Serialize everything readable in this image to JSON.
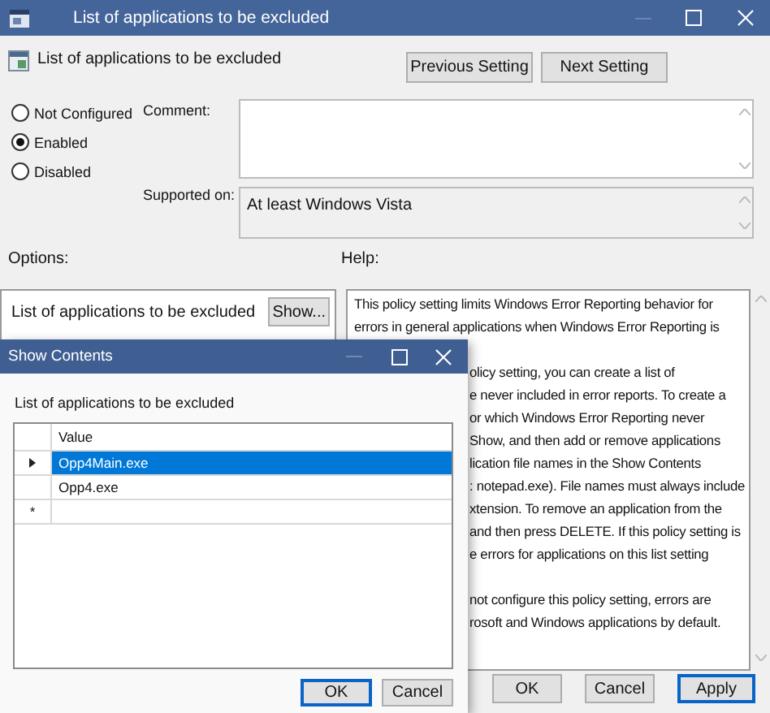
{
  "window": {
    "title": "List of applications to be excluded"
  },
  "header": {
    "title": "List of applications to be excluded",
    "buttons": [
      {
        "label": "Previous Setting"
      },
      {
        "label": "Next Setting"
      }
    ]
  },
  "state_options": [
    {
      "label": "Not Configured",
      "selected": false
    },
    {
      "label": "Enabled",
      "selected": true
    },
    {
      "label": "Disabled",
      "selected": false
    }
  ],
  "comment": {
    "label": "Comment:"
  },
  "supported_on": {
    "label": "Supported on:",
    "value": "At least Windows Vista"
  },
  "options": {
    "label": "Options:",
    "items": [
      {
        "label": "List of applications to be excluded",
        "button": "Show..."
      }
    ]
  },
  "help": {
    "label": "Help:",
    "paragraphs": [
      {
        "covered": false,
        "lines": [
          "This policy setting limits Windows Error Reporting behavior for",
          "errors in general applications when Windows Error Reporting is"
        ]
      },
      {
        "covered": true,
        "lines": [
          "olicy setting, you can create a list of",
          "e never included in error reports. To create a",
          "or which Windows Error Reporting never",
          "Show, and then add or remove applications",
          "lication file names in the Show Contents",
          ": notepad.exe). File names must always include",
          "xtension. To remove an application from the",
          "and then press DELETE. If this policy setting is",
          "e errors for applications on this list setting"
        ]
      },
      {
        "covered": true,
        "lines": [
          "not configure this policy setting, errors are",
          "rosoft and Windows applications by default."
        ]
      }
    ]
  },
  "footer_buttons": [
    {
      "label": "OK",
      "focused": false
    },
    {
      "label": "Cancel",
      "focused": false
    },
    {
      "label": "Apply",
      "focused": true
    }
  ],
  "dialog": {
    "title": "Show Contents",
    "label": "List of applications to be excluded",
    "table": {
      "columns": [
        "Value"
      ],
      "rows": [
        {
          "kind": "current",
          "value": "Opp4Main.exe",
          "selected": true
        },
        {
          "kind": "data",
          "value": "Opp4.exe",
          "selected": false
        },
        {
          "kind": "new",
          "marker": "*",
          "selected": false
        }
      ]
    },
    "buttons": [
      {
        "label": "OK",
        "focused": true
      },
      {
        "label": "Cancel",
        "focused": false
      }
    ]
  }
}
